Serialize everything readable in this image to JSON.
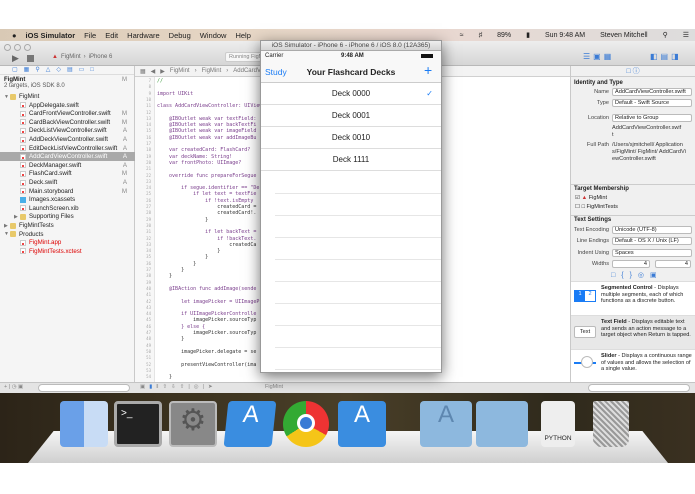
{
  "menubar": {
    "app": "iOS Simulator",
    "items": [
      "File",
      "Edit",
      "Hardware",
      "Debug",
      "Window",
      "Help"
    ],
    "battery": "89%",
    "clock": "Sun 9:48 AM",
    "user": "Steven Mitchell"
  },
  "xcode": {
    "scheme": "FigMint",
    "device": "iPhone 6",
    "activity": "Running FigMint",
    "navigator": {
      "project": "FigMint",
      "project_sub": "2 targets, iOS SDK 8.0",
      "project_status": "M",
      "items": [
        {
          "label": "FigMint",
          "type": "folder",
          "level": 1,
          "status": ""
        },
        {
          "label": "AppDelegate.swift",
          "type": "swift",
          "level": 2,
          "status": ""
        },
        {
          "label": "CardFrontViewController.swift",
          "type": "swift",
          "level": 2,
          "status": "M"
        },
        {
          "label": "CardBackViewController.swift",
          "type": "swift",
          "level": 2,
          "status": "M"
        },
        {
          "label": "DeckListViewController.swift",
          "type": "swift",
          "level": 2,
          "status": "A"
        },
        {
          "label": "AddDeckViewController.swift",
          "type": "swift",
          "level": 2,
          "status": "A"
        },
        {
          "label": "EditDeckListViewController.swift",
          "type": "swift",
          "level": 2,
          "status": "A"
        },
        {
          "label": "AddCardViewController.swift",
          "type": "swift",
          "level": 2,
          "status": "A",
          "selected": true
        },
        {
          "label": "DeckManager.swift",
          "type": "swift",
          "level": 2,
          "status": "A"
        },
        {
          "label": "FlashCard.swift",
          "type": "swift",
          "level": 2,
          "status": "M"
        },
        {
          "label": "Deck.swift",
          "type": "swift",
          "level": 2,
          "status": "A"
        },
        {
          "label": "Main.storyboard",
          "type": "file",
          "level": 2,
          "status": "M"
        },
        {
          "label": "Images.xcassets",
          "type": "assets",
          "level": 2,
          "status": ""
        },
        {
          "label": "LaunchScreen.xib",
          "type": "file",
          "level": 2,
          "status": ""
        },
        {
          "label": "Supporting Files",
          "type": "folder",
          "level": 2,
          "status": ""
        },
        {
          "label": "FigMintTests",
          "type": "folder",
          "level": 1,
          "status": ""
        },
        {
          "label": "Products",
          "type": "folder",
          "level": 1,
          "status": ""
        },
        {
          "label": "FigMint.app",
          "type": "app",
          "level": 2,
          "status": "",
          "red": true
        },
        {
          "label": "FigMintTests.xctest",
          "type": "file",
          "level": 2,
          "status": "",
          "red": true
        }
      ]
    },
    "jumpbar": [
      "FigMint",
      "FigMint",
      "AddCardViewController.swift"
    ],
    "code": [
      {
        "n": "7",
        "t": "//"
      },
      {
        "n": "8",
        "t": ""
      },
      {
        "n": "9",
        "t": "import UIKit"
      },
      {
        "n": "10",
        "t": ""
      },
      {
        "n": "11",
        "t": "class AddCardViewController: UIViewController, UIImagePickerControllerDelegate {"
      },
      {
        "n": "12",
        "t": ""
      },
      {
        "n": "13",
        "t": "    @IBOutlet weak var textField:"
      },
      {
        "n": "14",
        "t": "    @IBOutlet weak var backTextFi"
      },
      {
        "n": "15",
        "t": "    @IBOutlet weak var imageField"
      },
      {
        "n": "16",
        "t": "    @IBOutlet weak var addImageBu"
      },
      {
        "n": "17",
        "t": ""
      },
      {
        "n": "18",
        "t": "    var createdCard: FlashCard?"
      },
      {
        "n": "19",
        "t": "    var deckName: String!"
      },
      {
        "n": "20",
        "t": "    var frontPhoto: UIImage?"
      },
      {
        "n": "21",
        "t": ""
      },
      {
        "n": "22",
        "t": "    override func prepareForSegue"
      },
      {
        "n": "23",
        "t": ""
      },
      {
        "n": "24",
        "t": "        if segue.identifier == \"De"
      },
      {
        "n": "25",
        "t": "            if let text = textFie"
      },
      {
        "n": "26",
        "t": "                if !text.isEmpty"
      },
      {
        "n": "27",
        "t": "                    createdCard ="
      },
      {
        "n": "28",
        "t": "                    createdCard!."
      },
      {
        "n": "29",
        "t": "                }"
      },
      {
        "n": "30",
        "t": ""
      },
      {
        "n": "31",
        "t": "                if let backText ="
      },
      {
        "n": "32",
        "t": "                    if !backText."
      },
      {
        "n": "33",
        "t": "                        createdCa"
      },
      {
        "n": "34",
        "t": "                    }"
      },
      {
        "n": "35",
        "t": "                }"
      },
      {
        "n": "36",
        "t": "            }"
      },
      {
        "n": "37",
        "t": "        }"
      },
      {
        "n": "38",
        "t": "    }"
      },
      {
        "n": "39",
        "t": ""
      },
      {
        "n": "40",
        "t": "    @IBAction func addImage(sende"
      },
      {
        "n": "41",
        "t": ""
      },
      {
        "n": "42",
        "t": "        let imagePicker = UIImageP"
      },
      {
        "n": "43",
        "t": ""
      },
      {
        "n": "44",
        "t": "        if UIImagePickerControlle"
      },
      {
        "n": "45",
        "t": "            imagePicker.sourceTyp"
      },
      {
        "n": "46",
        "t": "        } else {"
      },
      {
        "n": "47",
        "t": "            imagePicker.sourceTyp"
      },
      {
        "n": "48",
        "t": "        }"
      },
      {
        "n": "49",
        "t": ""
      },
      {
        "n": "50",
        "t": "        imagePicker.delegate = se"
      },
      {
        "n": "51",
        "t": ""
      },
      {
        "n": "52",
        "t": "        presentViewController(ima"
      },
      {
        "n": "53",
        "t": ""
      },
      {
        "n": "54",
        "t": "    }"
      }
    ],
    "inspector": {
      "identity_title": "Identity and Type",
      "name_label": "Name",
      "name": "AddCardViewController.swift",
      "type_label": "Type",
      "type": "Default - Swift Source",
      "location_label": "Location",
      "location": "Relative to Group",
      "location_path": "AddCardViewController.swift",
      "fullpath_label": "Full Path",
      "fullpath": "/Users/sjmitchell/ Applications/FigMint/ FigMint/ AddCardViewController.swift",
      "target_title": "Target Membership",
      "targets": [
        {
          "label": "FigMint",
          "checked": true
        },
        {
          "label": "FigMintTests",
          "checked": false
        }
      ],
      "text_title": "Text Settings",
      "encoding_label": "Text Encoding",
      "encoding": "Unicode (UTF-8)",
      "endings_label": "Line Endings",
      "endings": "Default - OS X / Unix (LF)",
      "indent_label": "Indent Using",
      "indent": "Spaces",
      "widths_label": "Widths",
      "tab_width": "4",
      "indent_width": "4",
      "library": [
        {
          "icon": "12",
          "title": "Segmented Control",
          "desc": " - Displays multiple segments, each of which functions as a discrete button."
        },
        {
          "icon": "Text",
          "title": "Text Field",
          "desc": " - Displays editable text and sends an action message to a target object when Return is tapped."
        },
        {
          "icon": "",
          "title": "Slider",
          "desc": " - Displays a continuous range of values and allows the selection of a single value."
        }
      ]
    },
    "bottombar_target": "FigMint"
  },
  "simulator": {
    "title": "iOS Simulator - iPhone 6 - iPhone 6 / iOS 8.0 (12A365)",
    "carrier": "Carrier",
    "time": "9:48 AM",
    "nav_left": "Study",
    "nav_title": "Your Flashcard Decks",
    "nav_right": "+",
    "decks": [
      {
        "name": "Deck 0000",
        "checked": true
      },
      {
        "name": "Deck 0001"
      },
      {
        "name": "Deck 0010"
      },
      {
        "name": "Deck 1111"
      }
    ],
    "accent": "#1a7cf5"
  },
  "dock": {
    "apps": [
      "Finder",
      "Terminal",
      "System Preferences",
      "Xcode",
      "Chrome",
      "iOS Simulator",
      "Applications",
      "Documents",
      "PYTHON",
      "Trash"
    ]
  }
}
